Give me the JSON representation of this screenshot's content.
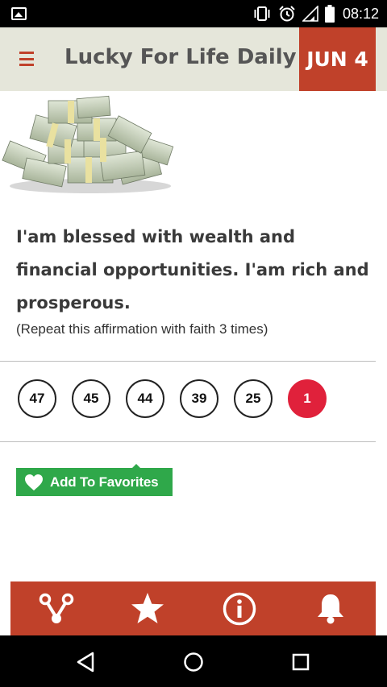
{
  "status_bar": {
    "time": "08:12",
    "icons": [
      "gallery-icon",
      "vibrate-icon",
      "alarm-icon",
      "signal-icon",
      "battery-icon"
    ]
  },
  "header": {
    "menu_icon": "hamburger-menu-icon",
    "title": "Lucky For Life Daily",
    "date": "JUN 4"
  },
  "affirmation": {
    "text": "I'am blessed with wealth and financial opportunities. I'am rich and prosperous.",
    "note": "(Repeat this affirmation with faith 3 times)"
  },
  "numbers": {
    "main": [
      "47",
      "45",
      "44",
      "39",
      "25"
    ],
    "lucky_ball": "1"
  },
  "favorites": {
    "label": "Add To Favorites",
    "icon": "heart-icon"
  },
  "toolbar": {
    "icons": [
      "share-icon",
      "star-icon",
      "info-icon",
      "bell-icon"
    ]
  },
  "nav_bar": {
    "icons": [
      "back-icon",
      "home-icon",
      "recents-icon"
    ]
  },
  "colors": {
    "brand": "#c0412a",
    "header_bg": "#e5e6da",
    "lucky_ball": "#e0213b",
    "favorites_button": "#2fa84a"
  }
}
